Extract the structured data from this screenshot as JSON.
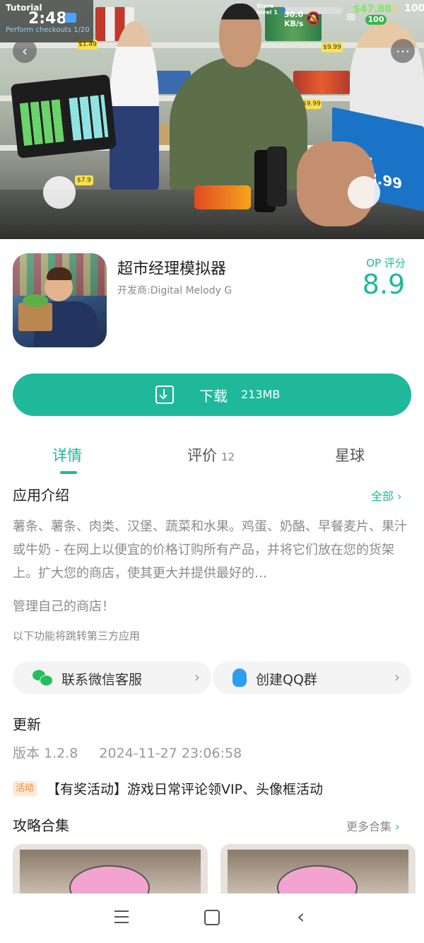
{
  "status_bar": {
    "tutorial_label": "Tutorial",
    "tutorial_progress": "Perform checkouts 1/20",
    "time": "2:48",
    "store_label": "Store",
    "level_label": "level 1",
    "net_speed": "30.0",
    "net_unit": "KB/s",
    "money": "$47.88",
    "battery_sub": "100",
    "battery": "100"
  },
  "hero": {
    "back_icon": "chevron-left-icon",
    "more_icon": "more-dots-icon",
    "screen_total": "AL: $28.99",
    "prices": [
      "$1.49",
      "$7.9",
      "$9.99",
      "$9.99"
    ]
  },
  "app": {
    "title": "超市经理模拟器",
    "developer": "开发商:Digital Melody G",
    "rating_label": "OP 评分",
    "rating": "8.9"
  },
  "download": {
    "label": "下载",
    "size": "213MB",
    "color": "#1fb89a"
  },
  "tabs": [
    {
      "label": "详情",
      "count": ""
    },
    {
      "label": "评价",
      "count": "12"
    },
    {
      "label": "星球",
      "count": ""
    }
  ],
  "intro": {
    "heading": "应用介绍",
    "all_link": "全部",
    "description": "薯条、薯条、肉类、汉堡、蔬菜和水果。鸡蛋、奶酪、早餐麦片、果汁或牛奶 - 在网上以便宜的价格订购所有产品，并将它们放在您的货架上。扩大您的商店，使其更大并提供最好的…",
    "manage": "管理自己的商店！",
    "third_party_note": "以下功能将跳转第三方应用"
  },
  "buttons": {
    "wechat": "联系微信客服",
    "qq": "创建QQ群"
  },
  "update": {
    "heading": "更新",
    "version": "版本 1.2.8",
    "date": "2024-11-27 23:06:58"
  },
  "activity": {
    "tag": "活动",
    "text": "【有奖活动】游戏日常评论领VIP、头像框活动"
  },
  "guides": {
    "heading": "攻略合集",
    "more": "更多合集"
  }
}
